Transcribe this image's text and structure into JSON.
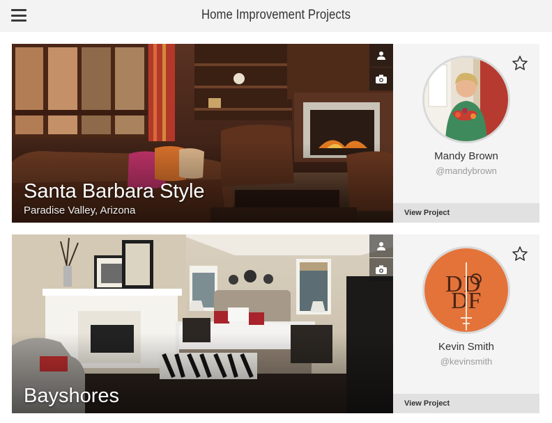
{
  "header": {
    "title": "Home Improvement Projects",
    "menu_icon": "hamburger-menu-icon"
  },
  "projects": [
    {
      "title": "Santa Barbara Style",
      "location": "Paradise Valley, Arizona",
      "designer": {
        "name": "Mandy Brown",
        "handle": "@mandybrown"
      },
      "view_label": "View Project",
      "icons": [
        "person-icon",
        "camera-icon",
        "star-outline-icon"
      ]
    },
    {
      "title": "Bayshores",
      "location": "",
      "designer": {
        "name": "Kevin Smith",
        "handle": "@kevinsmith"
      },
      "view_label": "View Project",
      "icons": [
        "person-icon",
        "camera-icon",
        "star-outline-icon"
      ]
    }
  ]
}
